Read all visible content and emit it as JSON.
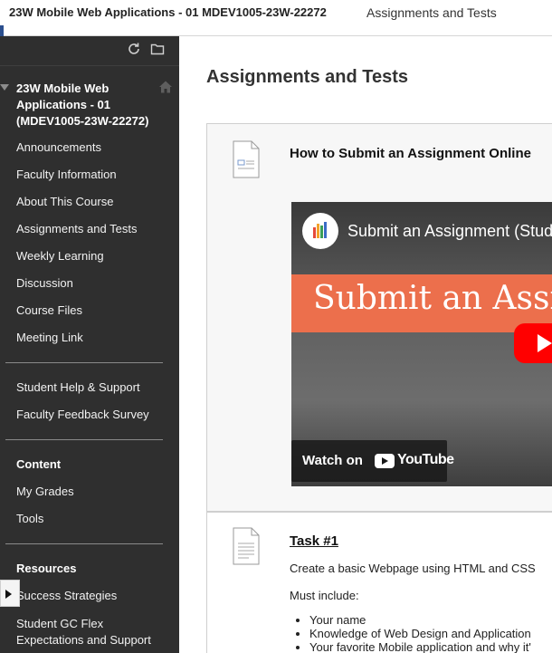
{
  "breadcrumb": {
    "course": "23W Mobile Web Applications - 01 MDEV1005-23W-22272",
    "page": "Assignments and Tests"
  },
  "sidebar": {
    "tools": [
      "refresh-icon",
      "folder-icon"
    ],
    "course_title": "23W Mobile Web Applications - 01 (MDEV1005-23W-22272)",
    "items": [
      {
        "label": "Announcements"
      },
      {
        "label": "Faculty Information"
      },
      {
        "label": "About This Course"
      },
      {
        "label": "Assignments and Tests"
      },
      {
        "label": "Weekly Learning"
      },
      {
        "label": "Discussion"
      },
      {
        "label": "Course Files"
      },
      {
        "label": "Meeting Link"
      }
    ],
    "support_items": [
      {
        "label": "Student Help & Support"
      },
      {
        "label": "Faculty Feedback Survey"
      }
    ],
    "content_heading": "Content",
    "content_items": [
      {
        "label": "My Grades"
      },
      {
        "label": "Tools"
      }
    ],
    "resources_heading": "Resources",
    "resources_items": [
      {
        "label": "Success Strategies"
      },
      {
        "label": "Student GC Flex Expectations and Support"
      }
    ]
  },
  "main": {
    "page_title": "Assignments and Tests",
    "item1": {
      "title": "How to Submit an Assignment Online",
      "video": {
        "title": "Submit an Assignment (Stud",
        "banner": "Submit an Assi",
        "watch_on": "Watch on",
        "youtube": "YouTube"
      }
    },
    "item2": {
      "title": "Task #1",
      "description": "Create a basic Webpage using HTML and CSS",
      "must_include": "Must include:",
      "bullets": [
        "Your name",
        "Knowledge of Web Design and Application",
        "Your favorite Mobile application and why it'"
      ]
    }
  },
  "colors": {
    "sidebar_bg": "#2f2f2f",
    "accent": "#2b4f8e",
    "video_banner": "#ec6f4c",
    "youtube_red": "#ff0000"
  }
}
